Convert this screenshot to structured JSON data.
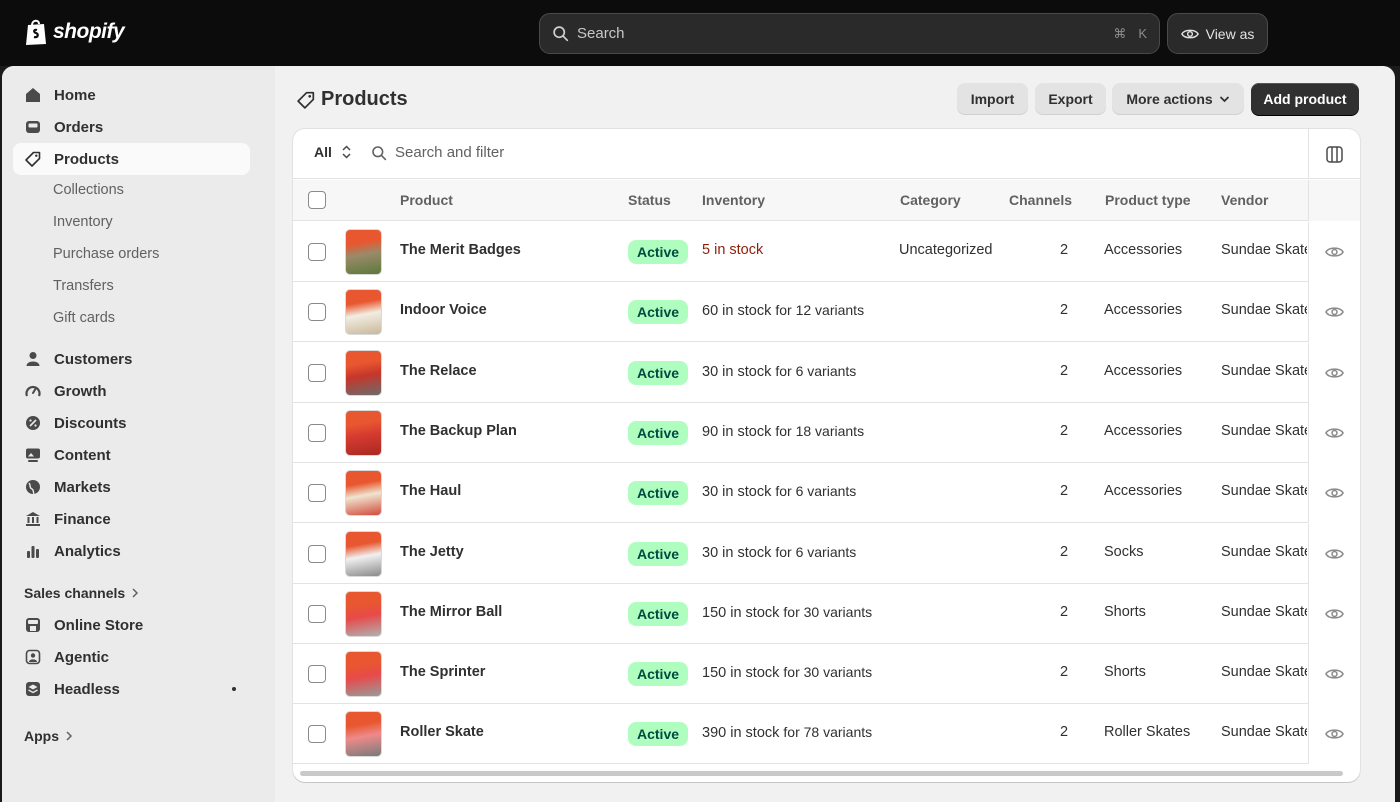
{
  "brand": {
    "name": "shopify"
  },
  "topbar": {
    "search_placeholder": "Search",
    "shortcut_cmd": "⌘",
    "shortcut_key": "K",
    "view_as": "View as"
  },
  "sidebar": {
    "main": [
      {
        "label": "Home",
        "icon": "home-icon"
      },
      {
        "label": "Orders",
        "icon": "inbox-icon"
      },
      {
        "label": "Products",
        "icon": "tag-icon",
        "active": true
      }
    ],
    "product_sub": [
      "Collections",
      "Inventory",
      "Purchase orders",
      "Transfers",
      "Gift cards"
    ],
    "secondary": [
      {
        "label": "Customers",
        "icon": "person-icon"
      },
      {
        "label": "Growth",
        "icon": "gauge-icon"
      },
      {
        "label": "Discounts",
        "icon": "discount-icon"
      },
      {
        "label": "Content",
        "icon": "image-icon"
      },
      {
        "label": "Markets",
        "icon": "globe-icon"
      },
      {
        "label": "Finance",
        "icon": "bank-icon"
      },
      {
        "label": "Analytics",
        "icon": "bar-chart-icon"
      }
    ],
    "sales_channels_label": "Sales channels",
    "channels": [
      {
        "label": "Online Store",
        "icon": "store-icon"
      },
      {
        "label": "Agentic",
        "icon": "robot-icon"
      },
      {
        "label": "Headless",
        "icon": "stack-icon"
      }
    ],
    "apps_label": "Apps"
  },
  "page": {
    "title": "Products",
    "buttons": {
      "import": "Import",
      "export": "Export",
      "more_actions": "More actions",
      "add_product": "Add product"
    }
  },
  "filters": {
    "tab_all": "All",
    "search_placeholder": "Search and filter"
  },
  "table": {
    "columns": [
      "Product",
      "Status",
      "Inventory",
      "Category",
      "Channels",
      "Product type",
      "Vendor"
    ],
    "rows": [
      {
        "name": "The Merit Badges",
        "status": "Active",
        "inventory": "5 in stock",
        "variants": "",
        "category": "Uncategorized",
        "channels": "2",
        "type": "Accessories",
        "vendor": "Sundae Skate",
        "low": true,
        "thumb": [
          "#e8572f",
          "#9a8a6a",
          "#5c7a3a"
        ]
      },
      {
        "name": "Indoor Voice",
        "status": "Active",
        "inventory": "60 in stock",
        "variants": "for 12 variants",
        "category": "",
        "channels": "2",
        "type": "Accessories",
        "vendor": "Sundae Skate",
        "low": false,
        "thumb": [
          "#e8572f",
          "#f2ede2",
          "#c9b89a"
        ]
      },
      {
        "name": "The Relace",
        "status": "Active",
        "inventory": "30 in stock",
        "variants": "for 6 variants",
        "category": "",
        "channels": "2",
        "type": "Accessories",
        "vendor": "Sundae Skate",
        "low": false,
        "thumb": [
          "#e8572f",
          "#c7362a",
          "#6c6c6c"
        ]
      },
      {
        "name": "The Backup Plan",
        "status": "Active",
        "inventory": "90 in stock",
        "variants": "for 18 variants",
        "category": "",
        "channels": "2",
        "type": "Accessories",
        "vendor": "Sundae Skate",
        "low": false,
        "thumb": [
          "#e8572f",
          "#d63a30",
          "#a72a22"
        ]
      },
      {
        "name": "The Haul",
        "status": "Active",
        "inventory": "30 in stock",
        "variants": "for 6 variants",
        "category": "",
        "channels": "2",
        "type": "Accessories",
        "vendor": "Sundae Skate",
        "low": false,
        "thumb": [
          "#e8572f",
          "#efe4d0",
          "#d34a3a"
        ]
      },
      {
        "name": "The Jetty",
        "status": "Active",
        "inventory": "30 in stock",
        "variants": "for 6 variants",
        "category": "",
        "channels": "2",
        "type": "Socks",
        "vendor": "Sundae Skate",
        "low": false,
        "thumb": [
          "#e8572f",
          "#f0f0f0",
          "#8a8a8a"
        ]
      },
      {
        "name": "The Mirror Ball",
        "status": "Active",
        "inventory": "150 in stock",
        "variants": "for 30 variants",
        "category": "",
        "channels": "2",
        "type": "Shorts",
        "vendor": "Sundae Skate",
        "low": false,
        "thumb": [
          "#e8572f",
          "#e84a4a",
          "#b0b0b0"
        ]
      },
      {
        "name": "The Sprinter",
        "status": "Active",
        "inventory": "150 in stock",
        "variants": "for 30 variants",
        "category": "",
        "channels": "2",
        "type": "Shorts",
        "vendor": "Sundae Skate",
        "low": false,
        "thumb": [
          "#e8572f",
          "#e84a4a",
          "#9a9a9a"
        ]
      },
      {
        "name": "Roller Skate",
        "status": "Active",
        "inventory": "390 in stock",
        "variants": "for 78 variants",
        "category": "",
        "channels": "2",
        "type": "Roller Skates",
        "vendor": "Sundae Skate",
        "low": false,
        "thumb": [
          "#e8572f",
          "#ee8a8a",
          "#7a7a7a"
        ]
      }
    ]
  },
  "colors": {
    "active_badge_bg": "#affebf",
    "active_badge_text": "#014b40",
    "low_stock": "#8e1f0b",
    "primary_button": "#303030"
  }
}
